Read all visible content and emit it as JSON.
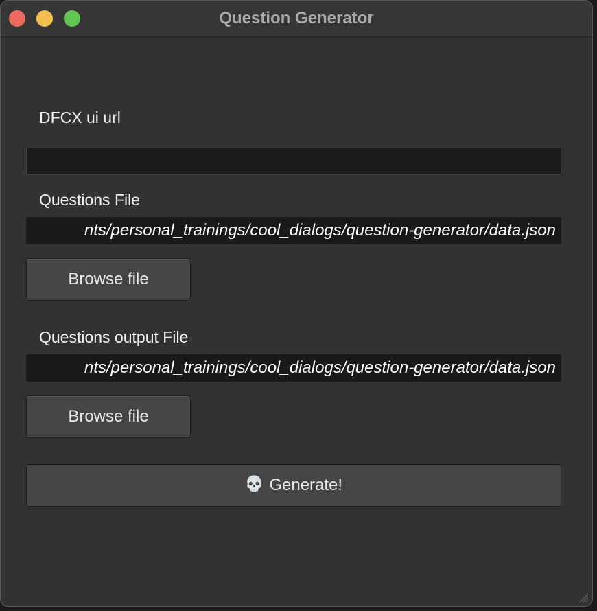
{
  "window": {
    "title": "Question Generator"
  },
  "form": {
    "dfcx_label": "DFCX ui url",
    "dfcx_value": "",
    "questions_label": "Questions File",
    "questions_value": "nts/personal_trainings/cool_dialogs/question-generator/data.json",
    "questions_browse": "Browse file",
    "output_label": "Questions output File",
    "output_value": "nts/personal_trainings/cool_dialogs/question-generator/data.json",
    "output_browse": "Browse file",
    "generate_icon": "💀",
    "generate_label": "Generate!"
  },
  "icons": {
    "close": "close-traffic-light-icon",
    "minimize": "minimize-traffic-light-icon",
    "maximize": "maximize-traffic-light-icon",
    "generate": "skull-icon",
    "resize": "resize-grip-icon"
  },
  "colors": {
    "window_bg": "#323232",
    "field_bg": "#191919",
    "button_bg": "#454545",
    "close": "#ee6a5e",
    "minimize": "#f5bf4f",
    "maximize": "#61c554"
  }
}
